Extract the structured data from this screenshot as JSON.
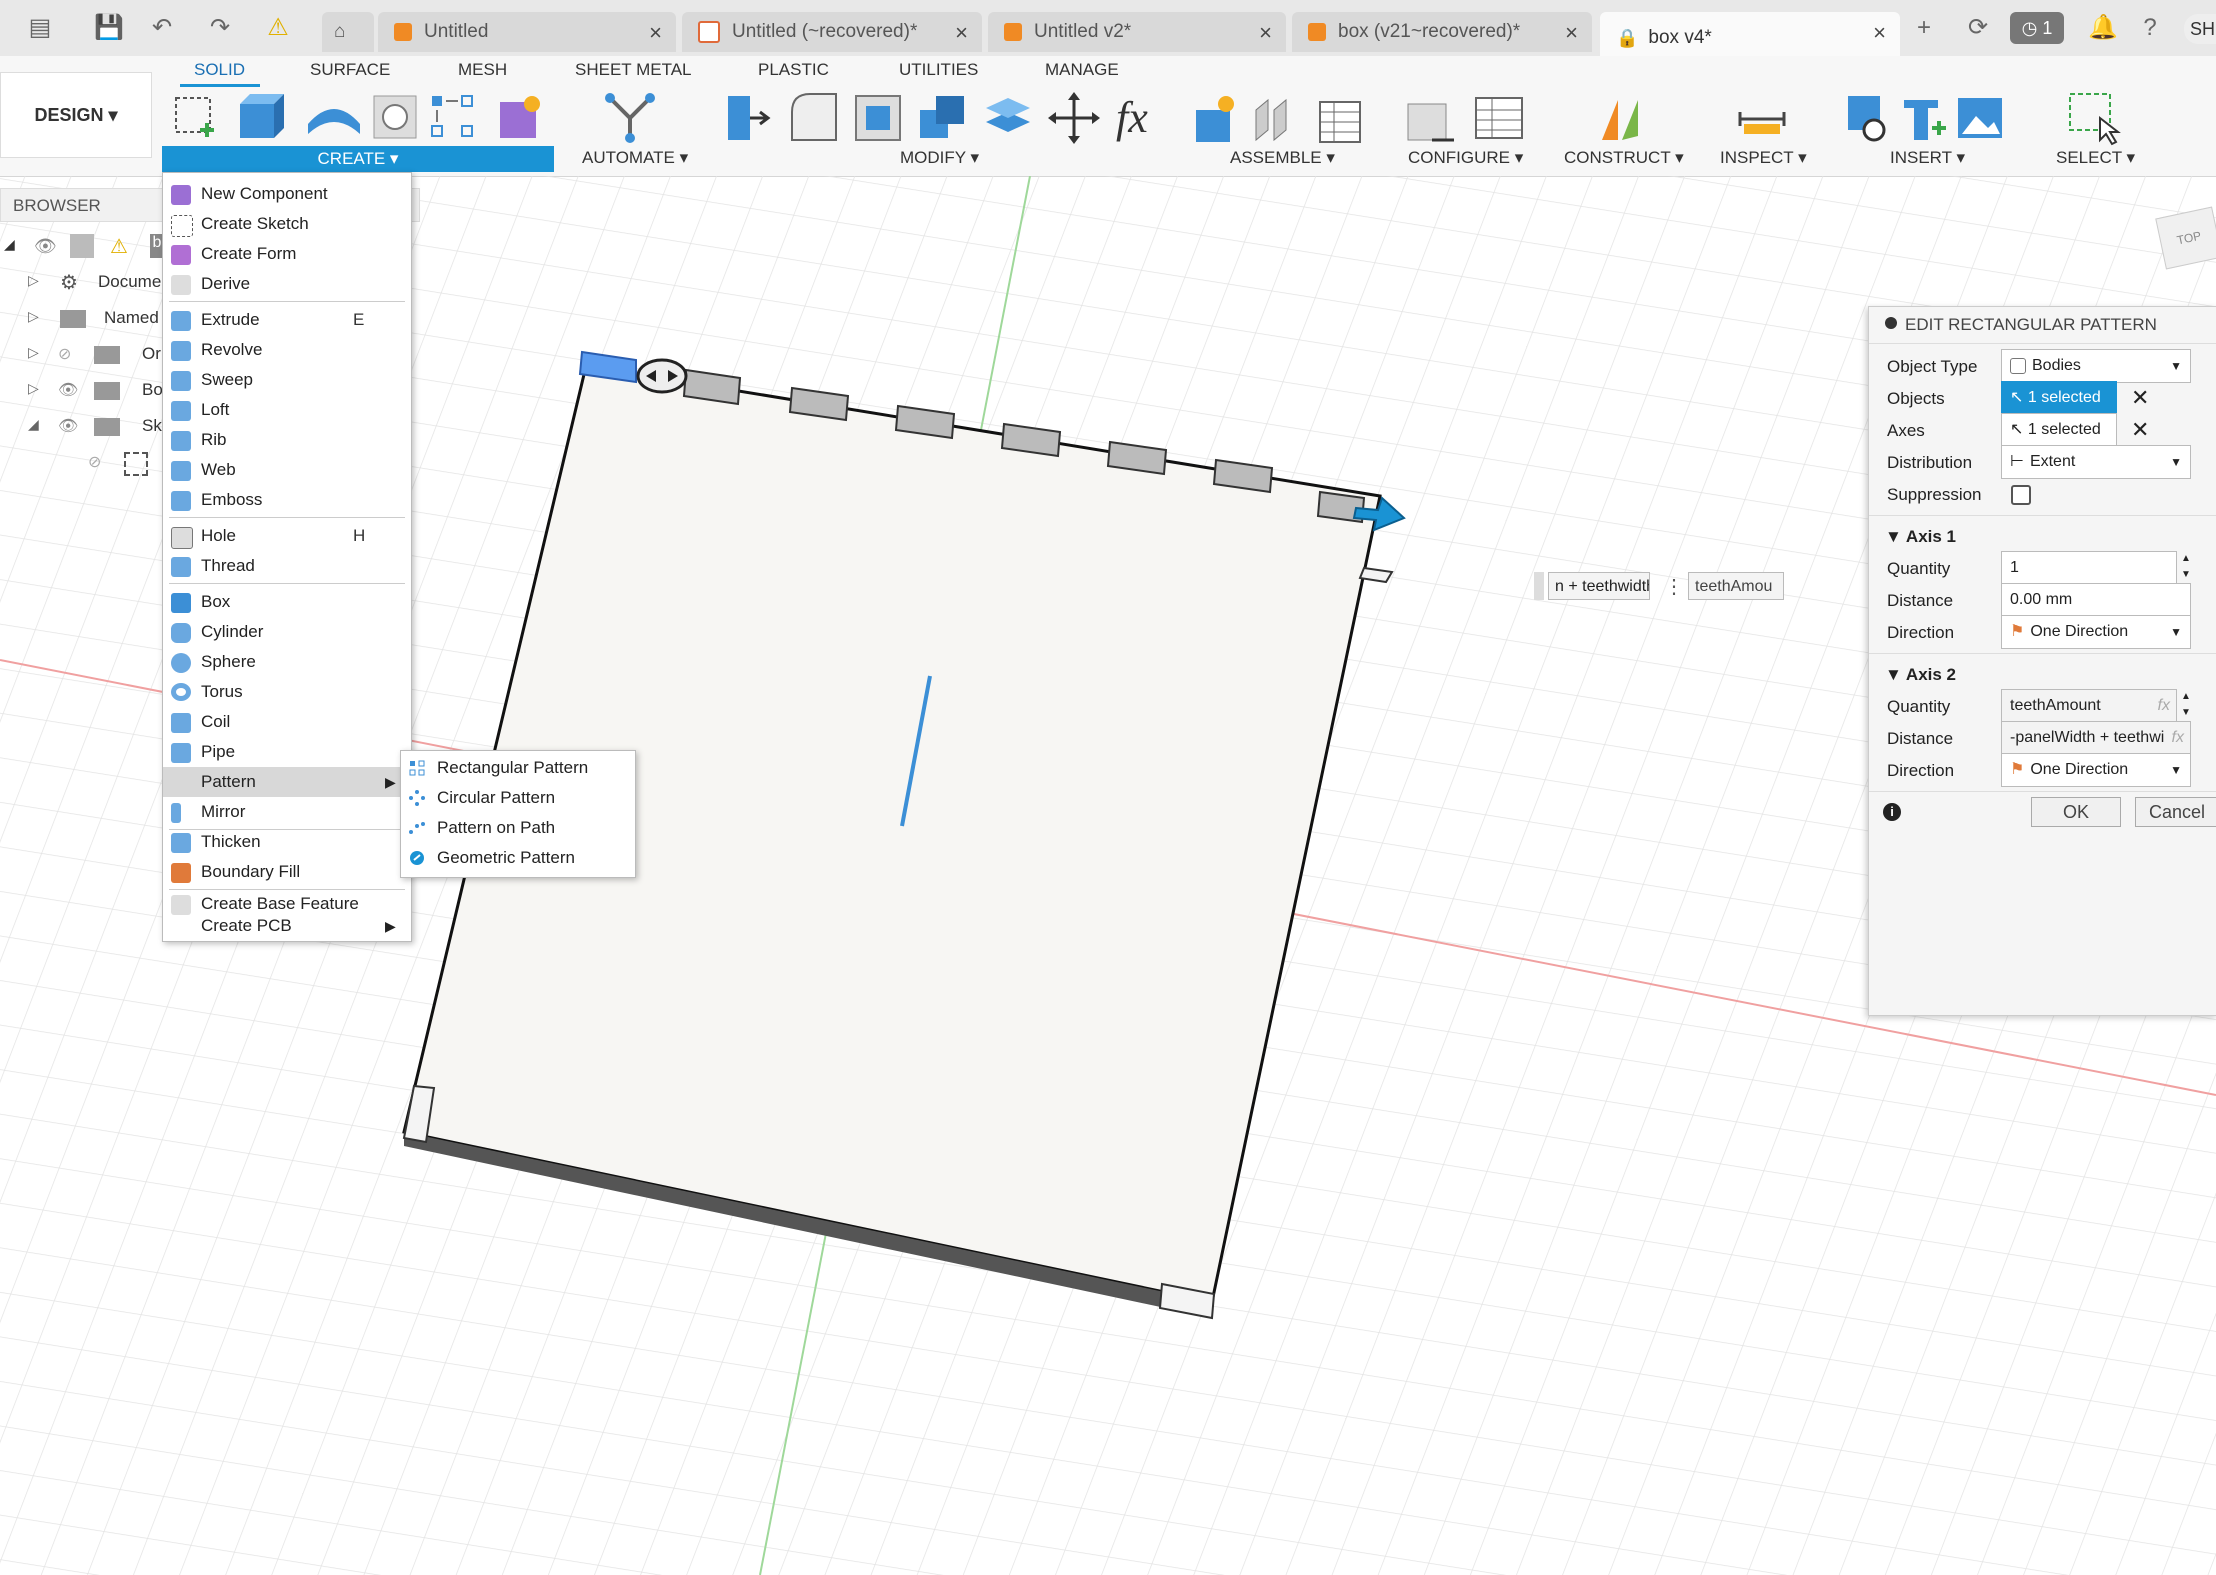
{
  "tabs": [
    {
      "label": "Untitled",
      "active": false
    },
    {
      "label": "Untitled (~recovered)*",
      "active": false
    },
    {
      "label": "Untitled v2*",
      "active": false
    },
    {
      "label": "box (v21~recovered)*",
      "active": false
    },
    {
      "label": "box v4*",
      "active": true
    }
  ],
  "top_right": {
    "job_count": "1",
    "user_initials": "SH"
  },
  "workspace": {
    "label": "DESIGN ▾"
  },
  "ribbon_tabs": [
    "SOLID",
    "SURFACE",
    "MESH",
    "SHEET METAL",
    "PLASTIC",
    "UTILITIES",
    "MANAGE"
  ],
  "ribbon_groups": [
    "CREATE ▾",
    "AUTOMATE ▾",
    "MODIFY ▾",
    "ASSEMBLE ▾",
    "CONFIGURE ▾",
    "CONSTRUCT ▾",
    "INSPECT ▾",
    "INSERT ▾",
    "SELECT ▾"
  ],
  "browser": {
    "title": "BROWSER",
    "rows": [
      "b",
      "Docume",
      "Named",
      "Or",
      "Bo",
      "Sk"
    ]
  },
  "create_menu": {
    "items": [
      {
        "label": "New Component",
        "key": ""
      },
      {
        "label": "Create Sketch",
        "key": ""
      },
      {
        "label": "Create Form",
        "key": ""
      },
      {
        "label": "Derive",
        "key": ""
      },
      {
        "label": "Extrude",
        "key": "E"
      },
      {
        "label": "Revolve",
        "key": ""
      },
      {
        "label": "Sweep",
        "key": ""
      },
      {
        "label": "Loft",
        "key": ""
      },
      {
        "label": "Rib",
        "key": ""
      },
      {
        "label": "Web",
        "key": ""
      },
      {
        "label": "Emboss",
        "key": ""
      },
      {
        "label": "Hole",
        "key": "H"
      },
      {
        "label": "Thread",
        "key": ""
      },
      {
        "label": "Box",
        "key": ""
      },
      {
        "label": "Cylinder",
        "key": ""
      },
      {
        "label": "Sphere",
        "key": ""
      },
      {
        "label": "Torus",
        "key": ""
      },
      {
        "label": "Coil",
        "key": ""
      },
      {
        "label": "Pipe",
        "key": ""
      },
      {
        "label": "Pattern",
        "key": ""
      },
      {
        "label": "Mirror",
        "key": ""
      },
      {
        "label": "Thicken",
        "key": ""
      },
      {
        "label": "Boundary Fill",
        "key": ""
      },
      {
        "label": "Create Base Feature",
        "key": ""
      },
      {
        "label": "Create PCB",
        "key": ""
      }
    ]
  },
  "pattern_submenu": [
    "Rectangular Pattern",
    "Circular Pattern",
    "Pattern on Path",
    "Geometric Pattern"
  ],
  "viewcube": {
    "label": "TOP"
  },
  "canvas_inputs": {
    "distance_expr": "n + teethwidth",
    "quantity_expr": "teethAmou"
  },
  "dialog": {
    "title": "EDIT RECTANGULAR PATTERN",
    "object_type_label": "Object Type",
    "object_type": "Bodies",
    "objects_label": "Objects",
    "objects": "1 selected",
    "axes_label": "Axes",
    "axes": "1 selected",
    "distribution_label": "Distribution",
    "distribution": "Extent",
    "suppression_label": "Suppression",
    "axis1": {
      "title": "Axis 1",
      "quantity_label": "Quantity",
      "quantity": "1",
      "distance_label": "Distance",
      "distance": "0.00 mm",
      "direction_label": "Direction",
      "direction": "One Direction"
    },
    "axis2": {
      "title": "Axis 2",
      "quantity_label": "Quantity",
      "quantity": "teethAmount",
      "distance_label": "Distance",
      "distance": "-panelWidth + teethwi",
      "direction_label": "Direction",
      "direction": "One Direction"
    },
    "fx": "fx",
    "ok": "OK",
    "cancel": "Cancel"
  },
  "colors": {
    "accent": "#1a93d4",
    "tab_icon": "#f08a24"
  }
}
